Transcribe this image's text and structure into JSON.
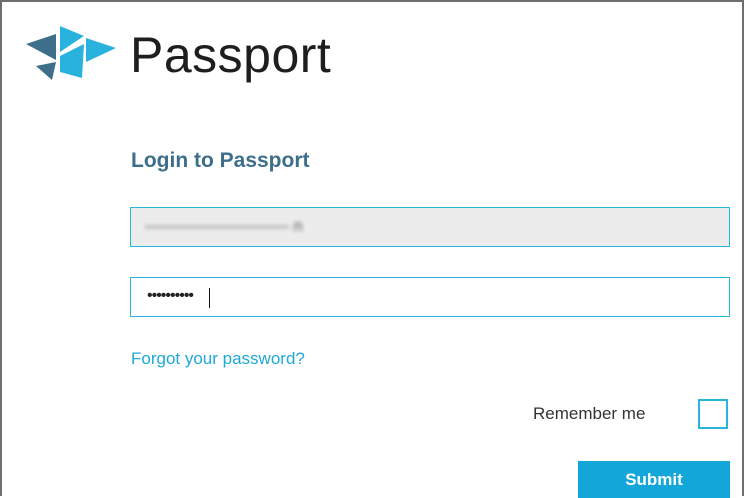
{
  "header": {
    "brand": "Passport",
    "logo_icon": "passport-logo-icon",
    "colors": {
      "logo_dark": "#3d6e8a",
      "logo_light": "#2ab2de"
    }
  },
  "form": {
    "title": "Login to Passport",
    "username_value": "————————— n",
    "password_mask": "••••••••••",
    "forgot_link": "Forgot your password?",
    "remember_label": "Remember me",
    "remember_checked": false,
    "submit_label": "Submit"
  },
  "colors": {
    "accent": "#29b5d9",
    "button": "#12a7d8",
    "title": "#3d6e8a",
    "link": "#1fa8d6"
  }
}
